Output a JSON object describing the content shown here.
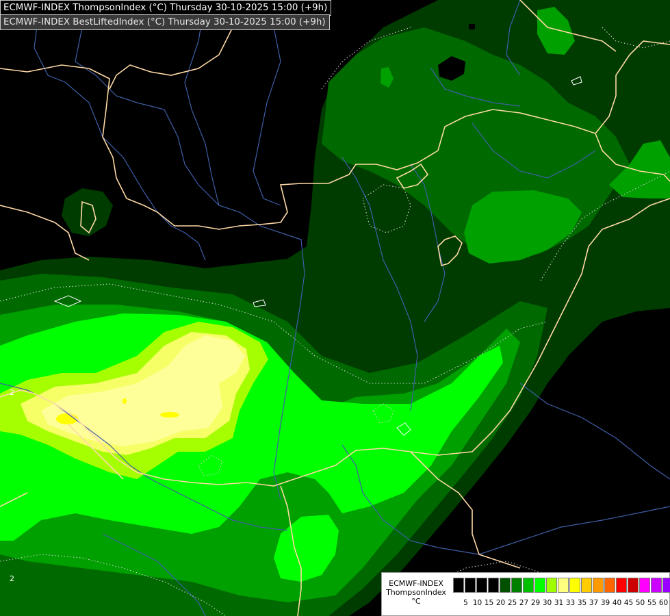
{
  "header": {
    "line1": "ECMWF-INDEX ThompsonIndex (°C) Thursday 30-10-2025 15:00 (+9h)",
    "line2": "ECMWF-INDEX BestLiftedIndex (°C) Thursday 30-10-2025 15:00 (+9h)"
  },
  "legend": {
    "title_line1": "ECMWF-INDEX",
    "title_line2": "ThompsonIndex",
    "title_line3": "°C",
    "ticks": [
      "5",
      "10",
      "15",
      "20",
      "25",
      "27",
      "29",
      "30",
      "31",
      "33",
      "35",
      "37",
      "39",
      "40",
      "45",
      "50",
      "55",
      "60"
    ],
    "colors": [
      "#000000",
      "#000000",
      "#000000",
      "#000000",
      "#005000",
      "#008000",
      "#00c000",
      "#00ff00",
      "#a0ff00",
      "#ffff7f",
      "#ffff00",
      "#ffcc00",
      "#ff9900",
      "#ff6600",
      "#ff0000",
      "#cc0000",
      "#ff00ff",
      "#cc00ff",
      "#9900ff",
      "#6600ff",
      "#0000ff"
    ]
  },
  "map": {
    "contour_labels": [
      "2",
      "2"
    ],
    "colors": {
      "zone_20": "#003c00",
      "zone_25": "#006a00",
      "zone_27": "#00a000",
      "zone_29": "#00ff00",
      "zone_30": "#a6ff00",
      "zone_31": "#f6ff66",
      "zone_33": "#ffff99",
      "zone_35": "#ffff00",
      "border": "#ffd9a6",
      "river": "#3f5fa8",
      "dotted": "#d0d0d0"
    }
  }
}
